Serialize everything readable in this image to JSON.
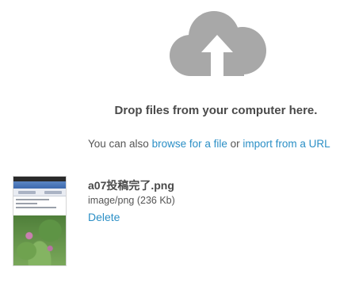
{
  "dropzone": {
    "upload_icon": "cloud-upload-icon",
    "icon_color": "#a8a8a8",
    "drop_text": "Drop files from your computer here.",
    "also_prefix": "You can also ",
    "browse_link": "browse for a file",
    "or_text": " or ",
    "import_link": "import from a URL"
  },
  "file": {
    "name": "a07投稿完了.png",
    "meta": "image/png (236 Kb)",
    "delete_label": "Delete"
  },
  "colors": {
    "link": "#2b8fc6",
    "heading_text": "#4a4a4a",
    "body_text": "#555555"
  }
}
